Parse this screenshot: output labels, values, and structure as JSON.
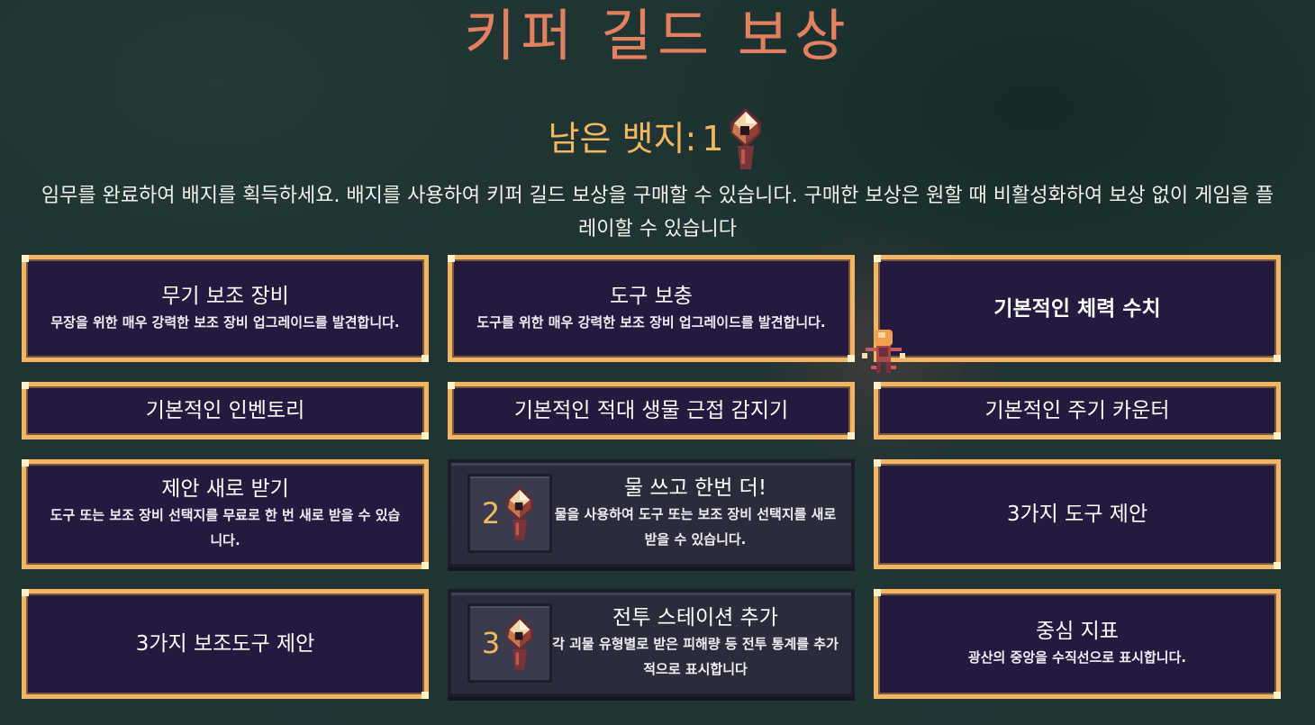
{
  "header": {
    "title": "키퍼 길드 보상",
    "badges_label": "남은 뱃지:",
    "badges_count": "1",
    "description": "임무를 완료하여 배지를 획득하세요. 배지를 사용하여 키퍼 길드 보상을 구매할 수 있습니다. 구매한 보상은 원할 때 비활성화하여 보상 없이 게임을 플레이할 수 있습니다"
  },
  "rewards": [
    {
      "title": "무기 보조 장비",
      "desc": "무장을 위한 매우 강력한 보조 장비 업그레이드를 발견합니다.",
      "state": "owned"
    },
    {
      "title": "도구 보충",
      "desc": "도구를 위한 매우 강력한 보조 장비 업그레이드를 발견합니다.",
      "state": "owned"
    },
    {
      "title": "기본적인 체력 수치",
      "desc": "",
      "state": "owned"
    },
    {
      "title": "기본적인 인벤토리",
      "desc": "",
      "state": "owned"
    },
    {
      "title": "기본적인 적대 생물 근접 감지기",
      "desc": "",
      "state": "owned"
    },
    {
      "title": "기본적인 주기 카운터",
      "desc": "",
      "state": "owned"
    },
    {
      "title": "제안 새로 받기",
      "desc": "도구 또는 보조 장비 선택지를 무료로 한 번 새로 받을 수 있습니다.",
      "state": "owned"
    },
    {
      "title": "물 쓰고 한번 더!",
      "desc": "물을 사용하여 도구 또는 보조 장비 선택지를 새로 받을 수 있습니다.",
      "state": "locked",
      "cost": "2"
    },
    {
      "title": "3가지 도구 제안",
      "desc": "",
      "state": "owned"
    },
    {
      "title": "3가지 보조도구 제안",
      "desc": "",
      "state": "owned"
    },
    {
      "title": "전투 스테이션 추가",
      "desc": "각 괴물 유형별로 받은 피해량 등 전투 통계를 추가적으로 표시합니다",
      "state": "locked",
      "cost": "3"
    },
    {
      "title": "중심 지표",
      "desc": "광산의 중앙을 수직선으로 표시합니다.",
      "state": "owned"
    }
  ],
  "colors": {
    "background": "#1f3433",
    "title": "#e3805f",
    "accent": "#f2b860",
    "card_bg": "#241a40",
    "card_border": "#f2b565",
    "locked_bg": "#2b2c3b"
  },
  "icons": {
    "badge": "badge-gem-icon",
    "character": "keeper-character-sprite"
  }
}
